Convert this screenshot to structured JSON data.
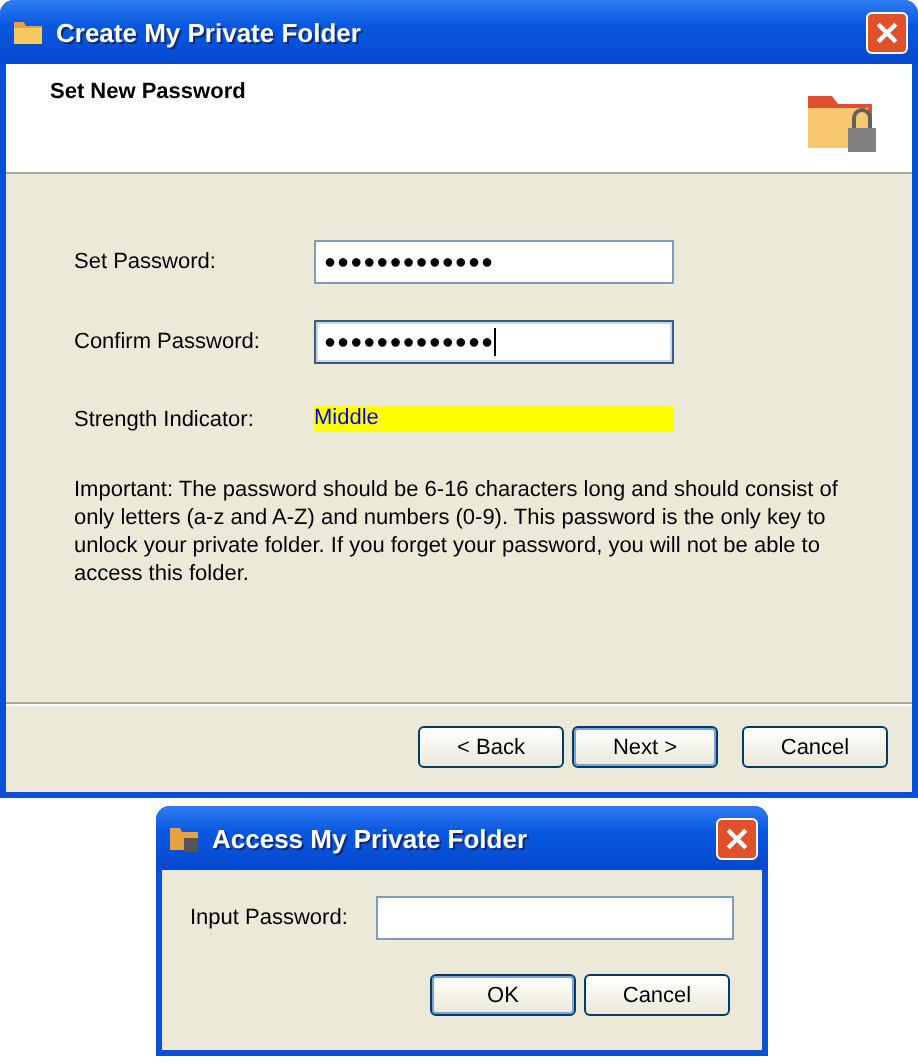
{
  "main_dialog": {
    "title": "Create My Private Folder",
    "header": "Set New Password",
    "fields": [
      {
        "label": "Set Password:",
        "value": "●●●●●●●●●●●●●",
        "focused": false
      },
      {
        "label": "Confirm Password:",
        "value": "●●●●●●●●●●●●●",
        "focused": true
      }
    ],
    "strength": {
      "label": "Strength Indicator:",
      "value": "Middle",
      "color": "#ffff00"
    },
    "note": "Important: The password should be 6-16 characters long and should consist of only letters (a-z and A-Z) and numbers (0-9). This password is the only key to unlock your private folder. If you forget your password, you will not be able to access this folder.",
    "buttons": [
      {
        "label": "< Back",
        "default": false
      },
      {
        "label": "Next >",
        "default": true
      },
      {
        "label": "Cancel",
        "default": false
      }
    ]
  },
  "access_dialog": {
    "title": "Access My Private Folder",
    "field": {
      "label": "Input Password:"
    },
    "buttons": [
      {
        "label": "OK",
        "default": true
      },
      {
        "label": "Cancel",
        "default": false
      }
    ]
  }
}
